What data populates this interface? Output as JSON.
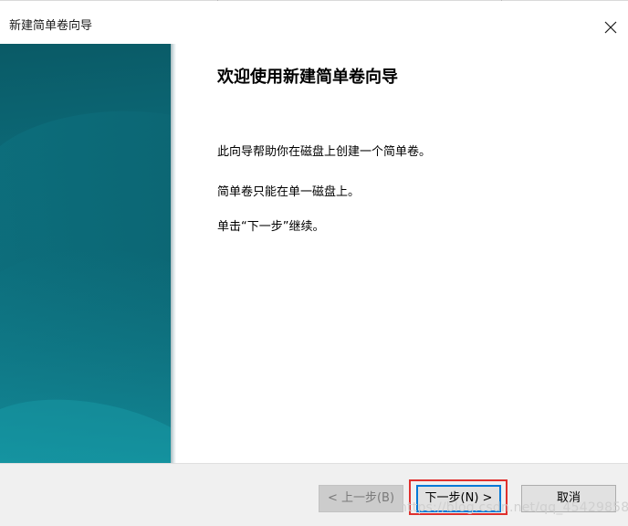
{
  "window": {
    "title": "新建简单卷向导",
    "close_symbol": "×"
  },
  "content": {
    "heading": "欢迎使用新建简单卷向导",
    "paragraphs": [
      "此向导帮助你在磁盘上创建一个简单卷。",
      "简单卷只能在单一磁盘上。",
      "单击“下一步”继续。"
    ]
  },
  "buttons": {
    "back_label": "< 上一步(B)",
    "next_label": "下一步(N) >",
    "cancel_label": "取消"
  },
  "watermark": "https://blog.csdn.net/qq_45429858",
  "colors": {
    "side_panel_dark": "#0a5a66",
    "side_panel_light": "#13909f",
    "next_button_focus": "#0078d7",
    "highlight_outline": "#e0302d"
  }
}
